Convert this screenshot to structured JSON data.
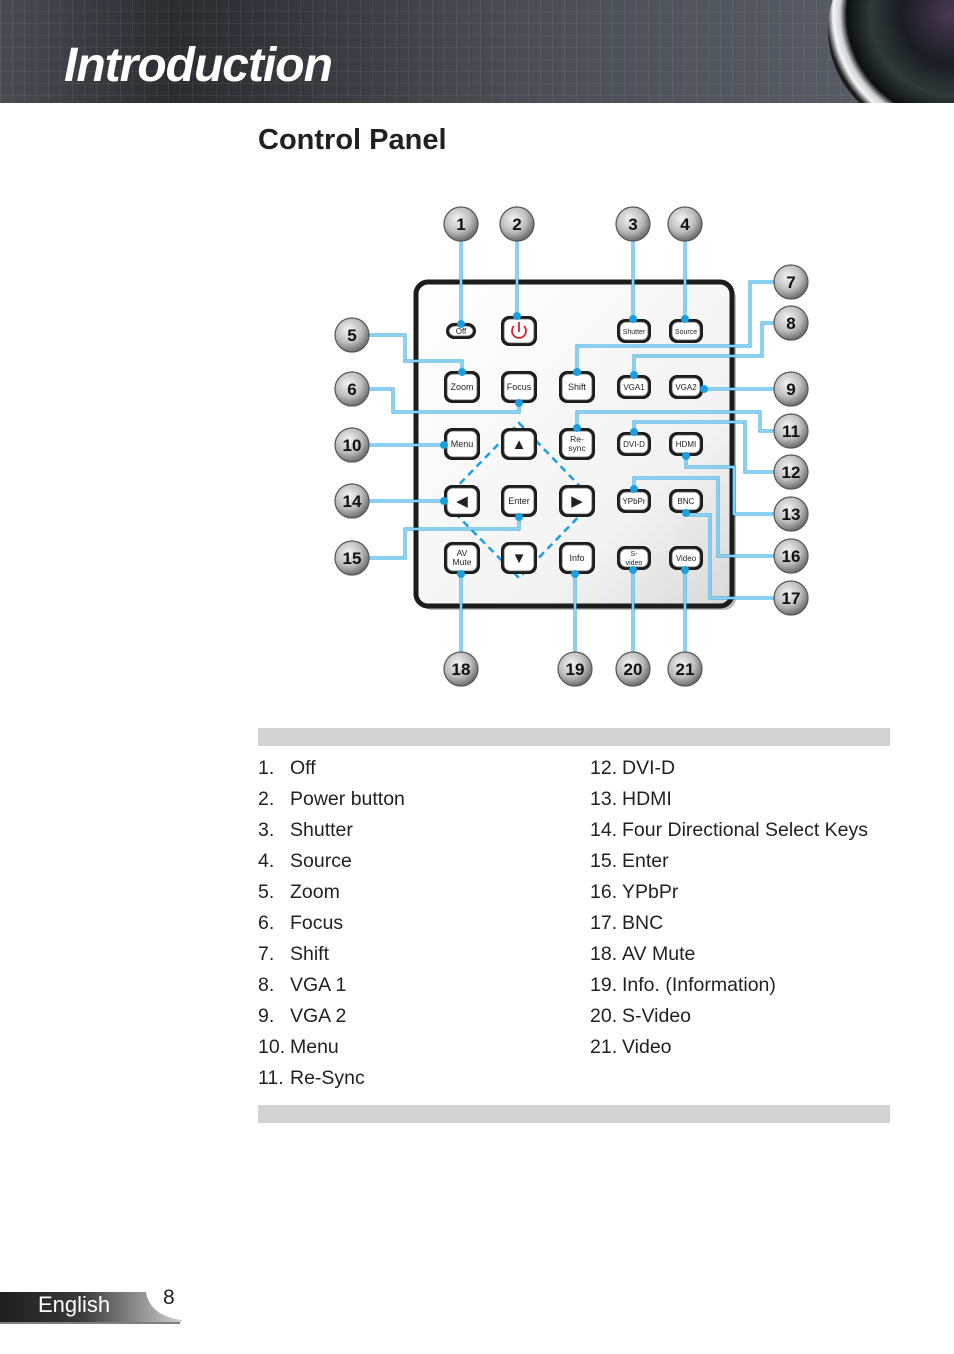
{
  "header": {
    "title": "Introduction",
    "lens_icon": "projector-lens-icon"
  },
  "section": {
    "title": "Control Panel"
  },
  "panel": {
    "buttons": [
      {
        "id": "off",
        "label": "Off"
      },
      {
        "id": "power",
        "label": "power-icon"
      },
      {
        "id": "shutter",
        "label": "Shutter"
      },
      {
        "id": "source",
        "label": "Source"
      },
      {
        "id": "zoom",
        "label": "Zoom"
      },
      {
        "id": "focus",
        "label": "Focus"
      },
      {
        "id": "shift",
        "label": "Shift"
      },
      {
        "id": "vga1",
        "label": "VGA1"
      },
      {
        "id": "vga2",
        "label": "VGA2"
      },
      {
        "id": "menu",
        "label": "Menu"
      },
      {
        "id": "up",
        "label": "▲"
      },
      {
        "id": "resync",
        "label": "Re-|sync"
      },
      {
        "id": "dvid",
        "label": "DVI-D"
      },
      {
        "id": "hdmi",
        "label": "HDMI"
      },
      {
        "id": "left",
        "label": "◀"
      },
      {
        "id": "enter",
        "label": "Enter"
      },
      {
        "id": "right",
        "label": "▶"
      },
      {
        "id": "ypbpr",
        "label": "YPbPr"
      },
      {
        "id": "bnc",
        "label": "BNC"
      },
      {
        "id": "avmute",
        "label": "AV|Mute"
      },
      {
        "id": "down",
        "label": "▼"
      },
      {
        "id": "info",
        "label": "Info"
      },
      {
        "id": "svideo",
        "label": "S-|video"
      },
      {
        "id": "video",
        "label": "Video"
      }
    ],
    "callouts": [
      "1",
      "2",
      "3",
      "4",
      "5",
      "6",
      "7",
      "8",
      "9",
      "10",
      "11",
      "12",
      "13",
      "14",
      "15",
      "16",
      "17",
      "18",
      "19",
      "20",
      "21"
    ],
    "accent_color": "#1aa0e0"
  },
  "legend": {
    "left": [
      {
        "num": "1.",
        "label": "Off"
      },
      {
        "num": "2.",
        "label": "Power button"
      },
      {
        "num": "3.",
        "label": "Shutter"
      },
      {
        "num": "4.",
        "label": "Source"
      },
      {
        "num": "5.",
        "label": "Zoom"
      },
      {
        "num": "6.",
        "label": "Focus"
      },
      {
        "num": "7.",
        "label": "Shift"
      },
      {
        "num": "8.",
        "label": "VGA 1"
      },
      {
        "num": "9.",
        "label": "VGA 2"
      },
      {
        "num": "10.",
        "label": "Menu"
      },
      {
        "num": "11.",
        "label": "Re-Sync"
      }
    ],
    "right": [
      {
        "num": "12.",
        "label": "DVI-D"
      },
      {
        "num": "13.",
        "label": "HDMI"
      },
      {
        "num": "14.",
        "label": "Four Directional Select Keys"
      },
      {
        "num": "15.",
        "label": "Enter"
      },
      {
        "num": "16.",
        "label": "YPbPr"
      },
      {
        "num": "17.",
        "label": "BNC"
      },
      {
        "num": "18.",
        "label": "AV Mute"
      },
      {
        "num": "19.",
        "label": "Info. (Information)"
      },
      {
        "num": "20.",
        "label": "S-Video"
      },
      {
        "num": "21.",
        "label": "Video"
      }
    ]
  },
  "footer": {
    "language": "English",
    "page": "8"
  }
}
